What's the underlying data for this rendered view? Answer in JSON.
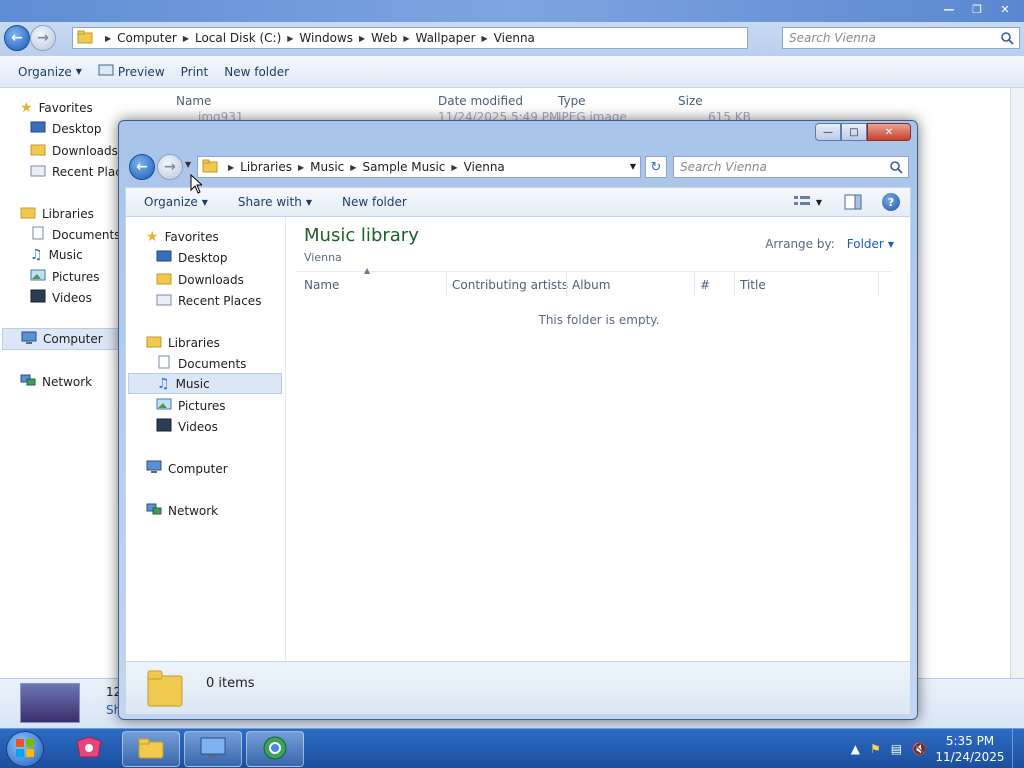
{
  "back_window": {
    "breadcrumb": [
      "Computer",
      "Local Disk (C:)",
      "Windows",
      "Web",
      "Wallpaper",
      "Vienna"
    ],
    "search_placeholder": "Search Vienna",
    "toolbar": {
      "organize": "Organize",
      "preview": "Preview",
      "print": "Print",
      "new_folder": "New folder"
    },
    "nav": {
      "favorites": "Favorites",
      "desktop": "Desktop",
      "downloads": "Downloads",
      "recent_places": "Recent Places",
      "libraries": "Libraries",
      "documents": "Documents",
      "music": "Music",
      "pictures": "Pictures",
      "videos": "Videos",
      "computer": "Computer",
      "network": "Network"
    },
    "columns": {
      "name": "Name",
      "date_modified": "Date modified",
      "type": "Type",
      "size": "Size"
    },
    "row": {
      "name": "img931",
      "date_modified": "11/24/2025 5:49 PM",
      "type": "JPEG image",
      "size": "615 KB"
    },
    "details": {
      "count_partial": "12",
      "sub_partial": "Sh"
    }
  },
  "front_window": {
    "breadcrumb": [
      "Libraries",
      "Music",
      "Sample Music",
      "Vienna"
    ],
    "search_placeholder": "Search Vienna",
    "toolbar": {
      "organize": "Organize",
      "share_with": "Share with",
      "new_folder": "New folder"
    },
    "nav": {
      "favorites": "Favorites",
      "desktop": "Desktop",
      "downloads": "Downloads",
      "recent_places": "Recent Places",
      "libraries": "Libraries",
      "documents": "Documents",
      "music": "Music",
      "pictures": "Pictures",
      "videos": "Videos",
      "computer": "Computer",
      "network": "Network"
    },
    "library_title": "Music library",
    "library_subtitle": "Vienna",
    "arrange_by_label": "Arrange by:",
    "arrange_by_value": "Folder",
    "columns": {
      "name": "Name",
      "artists": "Contributing artists",
      "album": "Album",
      "number": "#",
      "title": "Title"
    },
    "empty_message": "This folder is empty.",
    "details_count": "0 items"
  },
  "taskbar": {
    "time": "5:35 PM",
    "date": "11/24/2025"
  },
  "colors": {
    "library_title": "#1e5e2a",
    "link": "#1f5fb3",
    "taskbar": "#1b4f9e"
  }
}
